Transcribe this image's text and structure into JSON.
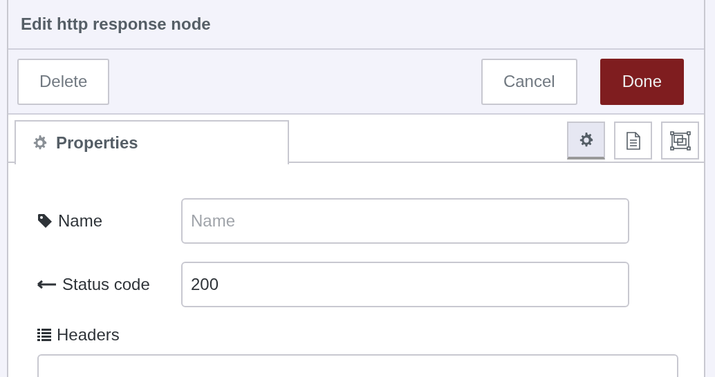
{
  "dialog": {
    "title": "Edit http response node"
  },
  "tray_buttons": [
    {
      "label": "Delete",
      "kind": "secondary"
    },
    {
      "label": "Cancel",
      "kind": "secondary"
    },
    {
      "label": "Done",
      "kind": "primary"
    }
  ],
  "tabs": [
    {
      "label": "Properties",
      "selected": true
    }
  ],
  "side_buttons": [
    {
      "kind": "gear",
      "selected": true
    },
    {
      "kind": "document",
      "selected": false
    },
    {
      "kind": "frame",
      "selected": false
    }
  ],
  "fields": [
    {
      "kind": "text",
      "label": "Name",
      "placeholder": "Name"
    },
    {
      "kind": "text",
      "label": "Status code",
      "value": "200"
    },
    {
      "kind": "list",
      "label": "Headers"
    }
  ]
}
